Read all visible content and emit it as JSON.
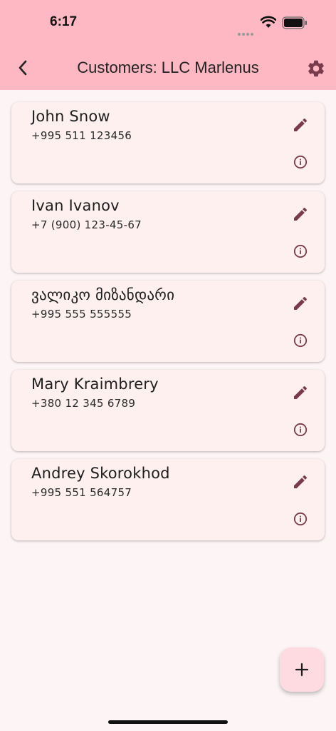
{
  "status_bar": {
    "time": "6:17"
  },
  "header": {
    "title": "Customers: LLC Marlenus"
  },
  "customers": [
    {
      "name": "John Snow",
      "phone": "+995 511 123456"
    },
    {
      "name": "Ivan Ivanov",
      "phone": "+7 (900) 123-45-67"
    },
    {
      "name": "ვალიკო მიზანდარი",
      "phone": "+995 555 555555"
    },
    {
      "name": "Mary Kraimbrery",
      "phone": "+380 12 345 6789"
    },
    {
      "name": "Andrey Skorokhod",
      "phone": "+995 551 564757"
    }
  ],
  "icons": {
    "back": "chevron-left-icon",
    "settings": "gear-icon",
    "edit": "pencil-icon",
    "info": "info-icon",
    "add": "plus-icon"
  },
  "colors": {
    "app_bar": "#fdb8c3",
    "background": "#fdf5f5",
    "card": "#fff0f0",
    "icon": "#7a3a4e",
    "fab": "#fddbe1"
  }
}
